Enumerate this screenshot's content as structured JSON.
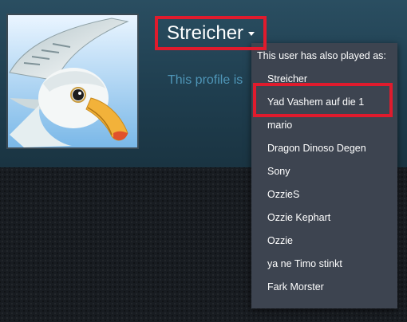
{
  "profile": {
    "persona_name": "Streicher",
    "private_notice": "This profile is"
  },
  "alias_dropdown": {
    "title": "This user has also played as:",
    "aliases": [
      "Streicher",
      "Yad Vashem auf die 1",
      "mario",
      "Dragon Dinoso Degen",
      "Sony",
      "OzzieS",
      "Ozzie Kephart",
      "Ozzie",
      "ya ne Timo stinkt",
      "Fark Morster"
    ]
  },
  "colors": {
    "highlight": "#e01b2d",
    "dropdown_bg": "#3d4450",
    "header_bg": "#2a4e61",
    "notice_text": "#4f96b8"
  },
  "icons": {
    "avatar": "seagull-image",
    "dropdown_caret": "caret-down-icon"
  }
}
